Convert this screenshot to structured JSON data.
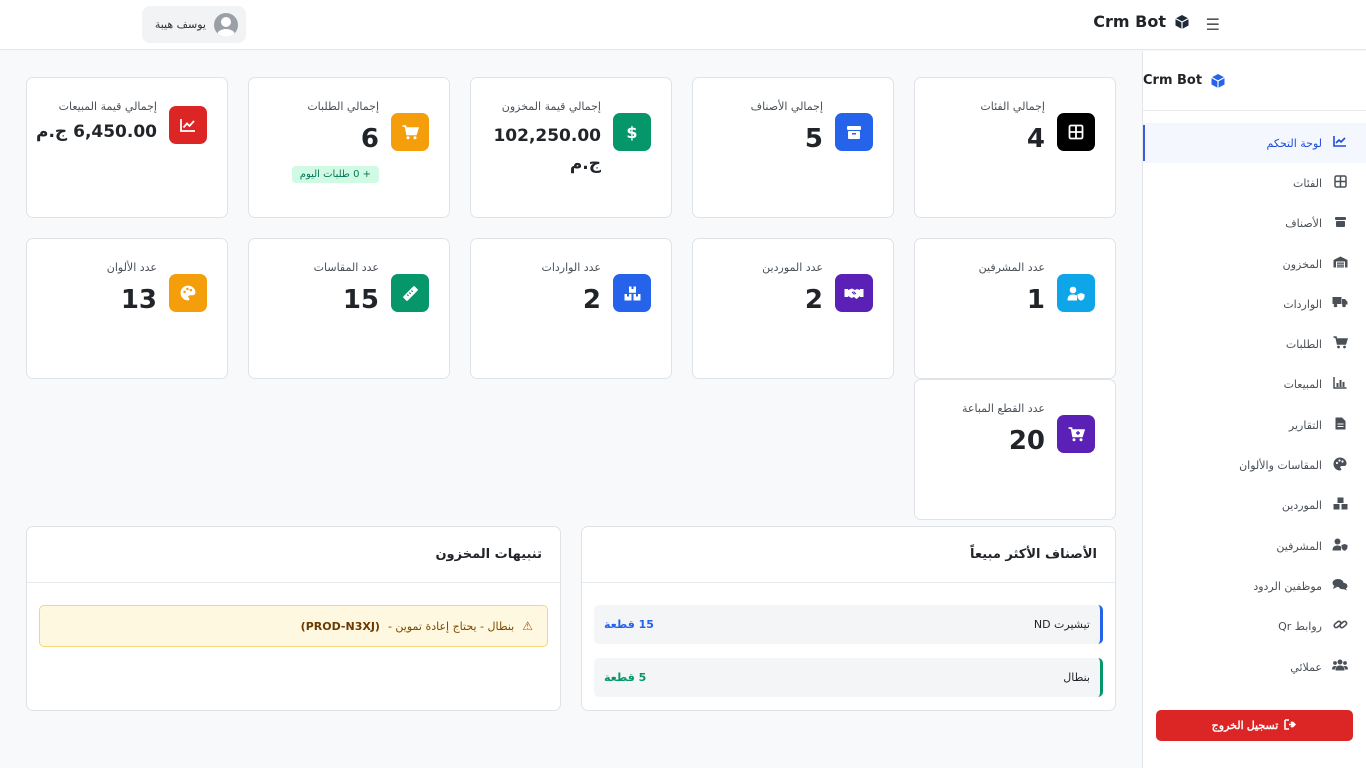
{
  "topbar": {
    "brand": "Crm Bot",
    "menu_icon": "hamburger-icon",
    "user_name": "يوسف هيبة"
  },
  "sidebar": {
    "brand": "Crm Bot",
    "items": [
      {
        "label": "لوحة التحكم",
        "icon": "chart-line-icon",
        "active": true
      },
      {
        "label": "الفئات",
        "icon": "grid-icon"
      },
      {
        "label": "الأصناف",
        "icon": "box-icon"
      },
      {
        "label": "المخزون",
        "icon": "warehouse-icon"
      },
      {
        "label": "الواردات",
        "icon": "truck-icon"
      },
      {
        "label": "الطلبات",
        "icon": "cart-icon"
      },
      {
        "label": "المبيعات",
        "icon": "bar-chart-icon"
      },
      {
        "label": "التقارير",
        "icon": "file-icon"
      },
      {
        "label": "المقاسات والألوان",
        "icon": "palette-icon"
      },
      {
        "label": "الموردين",
        "icon": "boxes-icon"
      },
      {
        "label": "المشرفين",
        "icon": "user-shield-icon"
      },
      {
        "label": "موظفين الردود",
        "icon": "comments-icon"
      },
      {
        "label": "روابط Qr",
        "icon": "link-icon"
      },
      {
        "label": "عملائي",
        "icon": "users-icon"
      }
    ],
    "logout": "تسجيل الخروج"
  },
  "cards": {
    "categories": {
      "title": "إجمالي الفئات",
      "value": "4",
      "color": "#000000"
    },
    "products": {
      "title": "إجمالي الأصناف",
      "value": "5",
      "color": "#2563eb"
    },
    "inventory": {
      "title": "إجمالي قيمة المخزون",
      "value": "102,250.00 ج.م",
      "color": "#059669"
    },
    "orders": {
      "title": "إجمالي الطلبات",
      "value": "6",
      "badge": "+ 0 طلبات اليوم",
      "color": "#f59e0b"
    },
    "sales": {
      "title": "إجمالي قيمة المبيعات",
      "value": "6,450.00 ج.م",
      "color": "#dc2626"
    },
    "supervisors": {
      "title": "عدد المشرفين",
      "value": "1",
      "color": "#0ea5e9"
    },
    "suppliers": {
      "title": "عدد الموردين",
      "value": "2",
      "color": "#5b21b6"
    },
    "imports": {
      "title": "عدد الواردات",
      "value": "2",
      "color": "#2563eb"
    },
    "sizes": {
      "title": "عدد المقاسات",
      "value": "15",
      "color": "#059669"
    },
    "colors": {
      "title": "عدد الألوان",
      "value": "13",
      "color": "#f59e0b"
    },
    "sold_pieces": {
      "title": "عدد القطع المباعة",
      "value": "20",
      "color": "#5b21b6"
    }
  },
  "best_sellers": {
    "title": "الأصناف الأكثر مبيعاً",
    "rows": [
      {
        "name": "تيشيرت ND",
        "qty": "15 قطعة",
        "color": "#2563eb"
      },
      {
        "name": "بنطال",
        "qty": "5 قطعة",
        "color": "#059669"
      }
    ]
  },
  "stock_alerts": {
    "title": "تنبيهات المخزون",
    "items": [
      {
        "text": "بنطال - يحتاج إعادة تموين -",
        "code": "(PROD-N3XJ)"
      }
    ]
  }
}
